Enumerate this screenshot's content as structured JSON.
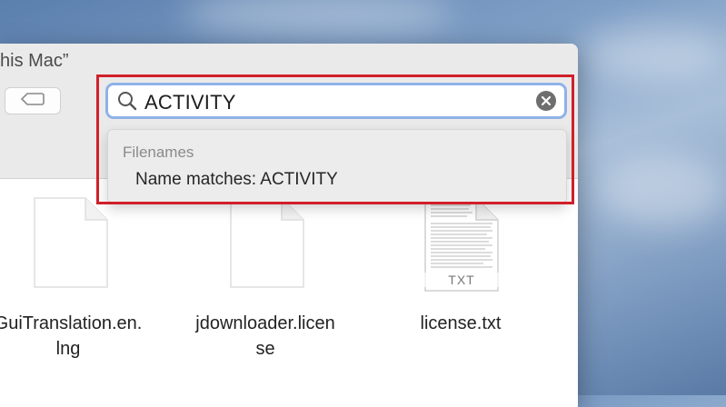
{
  "window": {
    "title": "his Mac”"
  },
  "toolbar": {
    "tag_button_icon": "tag-icon"
  },
  "search": {
    "value": "ACTIVITY",
    "search_icon": "search-icon",
    "clear_icon": "clear-circle-icon"
  },
  "suggestions": {
    "header": "Filenames",
    "items": [
      {
        "label": "Name matches: ACTIVITY"
      }
    ]
  },
  "files": [
    {
      "name_line1": "GuiTranslation.en.",
      "name_line2": "lng",
      "icon": "document-icon"
    },
    {
      "name_line1": "jdownloader.licen",
      "name_line2": "se",
      "icon": "document-icon"
    },
    {
      "name_line1": "license.txt",
      "name_line2": "",
      "icon": "text-file-icon",
      "badge": "TXT"
    }
  ],
  "colors": {
    "highlight_border": "#d0202a",
    "search_focus_ring": "#8fb2e8"
  }
}
